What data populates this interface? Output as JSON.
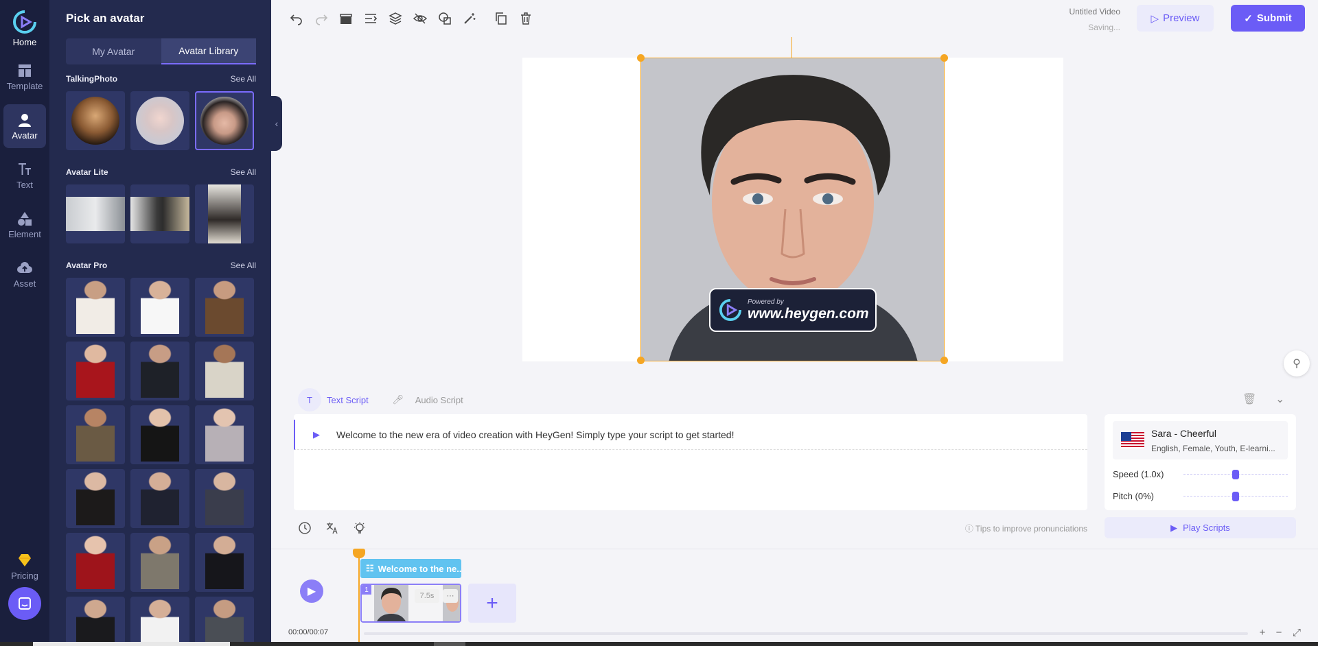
{
  "rail": {
    "home": "Home",
    "template": "Template",
    "avatar": "Avatar",
    "text": "Text",
    "element": "Element",
    "asset": "Asset",
    "pricing": "Pricing"
  },
  "panel": {
    "title": "Pick an avatar",
    "tabs": [
      "My Avatar",
      "Avatar Library"
    ],
    "active_tab": "Avatar Library",
    "sections": {
      "talking_photo": {
        "title": "TalkingPhoto",
        "see_all": "See All"
      },
      "avatar_lite": {
        "title": "Avatar Lite",
        "see_all": "See All"
      },
      "avatar_pro": {
        "title": "Avatar Pro",
        "see_all": "See All"
      }
    }
  },
  "header": {
    "video_title": "Untitled Video",
    "status": "Saving...",
    "preview": "Preview",
    "submit": "Submit"
  },
  "canvas": {
    "watermark_small": "Powered by",
    "watermark_big": "www.heygen.com"
  },
  "script": {
    "tab_text": "Text Script",
    "tab_audio": "Audio Script",
    "active_tab": "Text Script",
    "line": "Welcome to the new era of video creation with HeyGen! Simply type your script to get started!",
    "tips": "Tips to improve pronunciations"
  },
  "voice": {
    "name": "Sara - Cheerful",
    "desc": "English, Female, Youth, E-learni...",
    "speed_label": "Speed (1.0x)",
    "pitch_label": "Pitch (0%)",
    "speed_level": 0.5,
    "pitch_level": 0.5,
    "play_scripts": "Play Scripts"
  },
  "timeline": {
    "text_clip": "Welcome to the ne...",
    "scene_number": "1",
    "scene_duration": "7.5s",
    "time": "00:00/00:07"
  },
  "colors": {
    "accent": "#6b5cf6",
    "rail_bg": "#1a1f3d",
    "panel_bg": "#232a4e",
    "selection": "#f5a623",
    "text_clip": "#61c3f0"
  }
}
